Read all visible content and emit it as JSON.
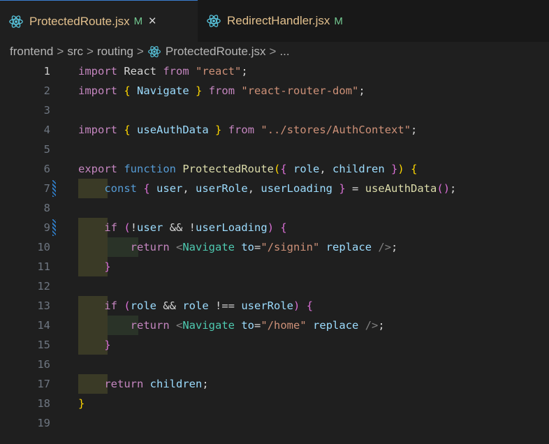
{
  "tabs": [
    {
      "name": "ProtectedRoute.jsx",
      "status": "M",
      "close": "×",
      "active": true,
      "icon": "react-icon"
    },
    {
      "name": "RedirectHandler.jsx",
      "status": "M",
      "active": false,
      "icon": "react-icon"
    }
  ],
  "breadcrumb": {
    "items": [
      "frontend",
      "src",
      "routing",
      "ProtectedRoute.jsx",
      "..."
    ],
    "separator": ">"
  },
  "editor": {
    "line_numbers": [
      "1",
      "2",
      "3",
      "4",
      "5",
      "6",
      "7",
      "8",
      "9",
      "10",
      "11",
      "12",
      "13",
      "14",
      "15",
      "16",
      "17",
      "18",
      "19"
    ],
    "current_line": 1,
    "lines": [
      [
        [
          "kw",
          "import"
        ],
        [
          "plain",
          " React "
        ],
        [
          "kw",
          "from"
        ],
        [
          "plain",
          " "
        ],
        [
          "str",
          "\"react\""
        ],
        [
          "plain",
          ";"
        ]
      ],
      [
        [
          "kw",
          "import"
        ],
        [
          "plain",
          " "
        ],
        [
          "br1",
          "{"
        ],
        [
          "plain",
          " "
        ],
        [
          "var",
          "Navigate"
        ],
        [
          "plain",
          " "
        ],
        [
          "br1",
          "}"
        ],
        [
          "plain",
          " "
        ],
        [
          "kw",
          "from"
        ],
        [
          "plain",
          " "
        ],
        [
          "str",
          "\"react-router-dom\""
        ],
        [
          "plain",
          ";"
        ]
      ],
      [],
      [
        [
          "kw",
          "import"
        ],
        [
          "plain",
          " "
        ],
        [
          "br1",
          "{"
        ],
        [
          "plain",
          " "
        ],
        [
          "var",
          "useAuthData"
        ],
        [
          "plain",
          " "
        ],
        [
          "br1",
          "}"
        ],
        [
          "plain",
          " "
        ],
        [
          "kw",
          "from"
        ],
        [
          "plain",
          " "
        ],
        [
          "str",
          "\"../stores/AuthContext\""
        ],
        [
          "plain",
          ";"
        ]
      ],
      [],
      [
        [
          "kw",
          "export"
        ],
        [
          "plain",
          " "
        ],
        [
          "kw2",
          "function"
        ],
        [
          "plain",
          " "
        ],
        [
          "fn",
          "ProtectedRoute"
        ],
        [
          "br1",
          "("
        ],
        [
          "br2",
          "{"
        ],
        [
          "plain",
          " "
        ],
        [
          "var",
          "role"
        ],
        [
          "plain",
          ", "
        ],
        [
          "var",
          "children"
        ],
        [
          "plain",
          " "
        ],
        [
          "br2",
          "}"
        ],
        [
          "br1",
          ")"
        ],
        [
          "plain",
          " "
        ],
        [
          "br1",
          "{"
        ]
      ],
      [
        [
          "plain",
          "    "
        ],
        [
          "kw2",
          "const"
        ],
        [
          "plain",
          " "
        ],
        [
          "br2",
          "{"
        ],
        [
          "plain",
          " "
        ],
        [
          "var",
          "user"
        ],
        [
          "plain",
          ", "
        ],
        [
          "var",
          "userRole"
        ],
        [
          "plain",
          ", "
        ],
        [
          "var",
          "userLoading"
        ],
        [
          "plain",
          " "
        ],
        [
          "br2",
          "}"
        ],
        [
          "plain",
          " = "
        ],
        [
          "fn",
          "useAuthData"
        ],
        [
          "br2",
          "("
        ],
        [
          "br2",
          ")"
        ],
        [
          "plain",
          ";"
        ]
      ],
      [],
      [
        [
          "plain",
          "    "
        ],
        [
          "kw",
          "if"
        ],
        [
          "plain",
          " "
        ],
        [
          "br2",
          "("
        ],
        [
          "plain",
          "!"
        ],
        [
          "var",
          "user"
        ],
        [
          "plain",
          " && !"
        ],
        [
          "var",
          "userLoading"
        ],
        [
          "br2",
          ")"
        ],
        [
          "plain",
          " "
        ],
        [
          "br2",
          "{"
        ]
      ],
      [
        [
          "plain",
          "        "
        ],
        [
          "kw",
          "return"
        ],
        [
          "plain",
          " "
        ],
        [
          "punct",
          "<"
        ],
        [
          "tag",
          "Navigate"
        ],
        [
          "plain",
          " "
        ],
        [
          "attr",
          "to"
        ],
        [
          "plain",
          "="
        ],
        [
          "str",
          "\"/signin\""
        ],
        [
          "plain",
          " "
        ],
        [
          "attr",
          "replace"
        ],
        [
          "plain",
          " "
        ],
        [
          "punct",
          "/>"
        ],
        [
          "plain",
          ";"
        ]
      ],
      [
        [
          "plain",
          "    "
        ],
        [
          "br2",
          "}"
        ]
      ],
      [],
      [
        [
          "plain",
          "    "
        ],
        [
          "kw",
          "if"
        ],
        [
          "plain",
          " "
        ],
        [
          "br2",
          "("
        ],
        [
          "var",
          "role"
        ],
        [
          "plain",
          " && "
        ],
        [
          "var",
          "role"
        ],
        [
          "plain",
          " !== "
        ],
        [
          "var",
          "userRole"
        ],
        [
          "br2",
          ")"
        ],
        [
          "plain",
          " "
        ],
        [
          "br2",
          "{"
        ]
      ],
      [
        [
          "plain",
          "        "
        ],
        [
          "kw",
          "return"
        ],
        [
          "plain",
          " "
        ],
        [
          "punct",
          "<"
        ],
        [
          "tag",
          "Navigate"
        ],
        [
          "plain",
          " "
        ],
        [
          "attr",
          "to"
        ],
        [
          "plain",
          "="
        ],
        [
          "str",
          "\"/home\""
        ],
        [
          "plain",
          " "
        ],
        [
          "attr",
          "replace"
        ],
        [
          "plain",
          " "
        ],
        [
          "punct",
          "/>"
        ],
        [
          "plain",
          ";"
        ]
      ],
      [
        [
          "plain",
          "    "
        ],
        [
          "br2",
          "}"
        ]
      ],
      [],
      [
        [
          "plain",
          "    "
        ],
        [
          "kw",
          "return"
        ],
        [
          "plain",
          " "
        ],
        [
          "var",
          "children"
        ],
        [
          "plain",
          ";"
        ]
      ],
      [
        [
          "br1",
          "}"
        ]
      ],
      []
    ],
    "indent_levels": [
      0,
      0,
      0,
      0,
      0,
      0,
      1,
      0,
      1,
      2,
      1,
      0,
      1,
      2,
      1,
      0,
      1,
      0,
      0
    ],
    "gutter_marks": [
      7,
      9
    ]
  },
  "colors": {
    "background": "#1f1f1f",
    "tab_modified": "#e2c08d",
    "status_M": "#73c991",
    "keyword": "#c586c0",
    "string": "#ce9178",
    "variable": "#9cdcfe",
    "function": "#dcdcaa",
    "jsx_tag": "#4ec9b0"
  }
}
